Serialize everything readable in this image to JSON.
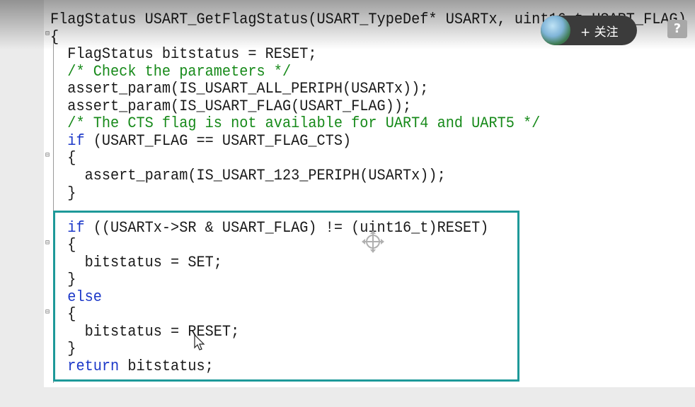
{
  "code_lines": [
    {
      "segments": [
        {
          "t": "FlagStatus USART_GetFlagStatus(USART_TypeDef* USARTx, uint16_t USART_FLAG)",
          "c": "plain"
        }
      ]
    },
    {
      "segments": [
        {
          "t": "{",
          "c": "plain"
        }
      ]
    },
    {
      "segments": [
        {
          "t": "  FlagStatus bitstatus = RESET;",
          "c": "plain"
        }
      ]
    },
    {
      "segments": [
        {
          "t": "  /* Check the parameters */",
          "c": "comment"
        }
      ]
    },
    {
      "segments": [
        {
          "t": "  assert_param(IS_USART_ALL_PERIPH(USARTx));",
          "c": "plain"
        }
      ]
    },
    {
      "segments": [
        {
          "t": "  assert_param(IS_USART_FLAG(USART_FLAG));",
          "c": "plain"
        }
      ]
    },
    {
      "segments": [
        {
          "t": "  /* The CTS flag is not available for UART4 and UART5 */",
          "c": "comment"
        }
      ]
    },
    {
      "segments": [
        {
          "t": "  ",
          "c": "plain"
        },
        {
          "t": "if",
          "c": "keyword"
        },
        {
          "t": " (USART_FLAG == USART_FLAG_CTS)",
          "c": "plain"
        }
      ]
    },
    {
      "segments": [
        {
          "t": "  {",
          "c": "plain"
        }
      ]
    },
    {
      "segments": [
        {
          "t": "    assert_param(IS_USART_123_PERIPH(USARTx));",
          "c": "plain"
        }
      ]
    },
    {
      "segments": [
        {
          "t": "  }",
          "c": "plain"
        }
      ]
    },
    {
      "segments": [
        {
          "t": "",
          "c": "plain"
        }
      ]
    },
    {
      "segments": [
        {
          "t": "  ",
          "c": "plain"
        },
        {
          "t": "if",
          "c": "keyword"
        },
        {
          "t": " ((USARTx->SR & USART_FLAG) != (uint16_t)RESET)",
          "c": "plain"
        }
      ]
    },
    {
      "segments": [
        {
          "t": "  {",
          "c": "plain"
        }
      ]
    },
    {
      "segments": [
        {
          "t": "    bitstatus = SET;",
          "c": "plain"
        }
      ]
    },
    {
      "segments": [
        {
          "t": "  }",
          "c": "plain"
        }
      ]
    },
    {
      "segments": [
        {
          "t": "  ",
          "c": "plain"
        },
        {
          "t": "else",
          "c": "keyword"
        }
      ]
    },
    {
      "segments": [
        {
          "t": "  {",
          "c": "plain"
        }
      ]
    },
    {
      "segments": [
        {
          "t": "    bitstatus = RESET;",
          "c": "plain"
        }
      ]
    },
    {
      "segments": [
        {
          "t": "  }",
          "c": "plain"
        }
      ]
    },
    {
      "segments": [
        {
          "t": "  ",
          "c": "plain"
        },
        {
          "t": "return",
          "c": "keyword"
        },
        {
          "t": " bitstatus;",
          "c": "plain"
        }
      ]
    }
  ],
  "overlay": {
    "follow_label": "+ 关注",
    "help_label": "?",
    "help_icon": "question-mark-icon",
    "avatar_icon": "user-avatar"
  },
  "colors": {
    "keyword": "#1c38c8",
    "comment": "#178a1a",
    "highlight_border": "#1e9999"
  }
}
